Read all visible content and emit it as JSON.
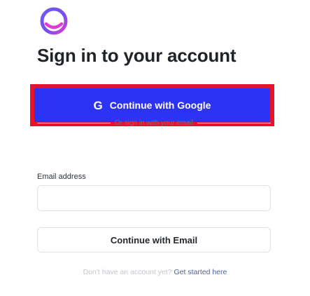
{
  "brand": {
    "logo_icon": "circle-smile-logo",
    "colors": {
      "logo_ring": "#6d5cf6",
      "logo_accent": "#e23bd5",
      "google_button_bg": "#2d33f5",
      "google_button_border": "#e5132b",
      "link": "#4f5fa0"
    }
  },
  "page": {
    "title": "Sign in to your account"
  },
  "google_button": {
    "icon": "google-g-icon",
    "icon_glyph": "G",
    "label": "Continue with Google"
  },
  "divider": {
    "text": "Or sign in with your email"
  },
  "email": {
    "label": "Email address",
    "value": "",
    "placeholder": ""
  },
  "email_button": {
    "label": "Continue with Email"
  },
  "signup": {
    "prompt": "Don't have an account yet?",
    "link_label": "Get started here"
  }
}
